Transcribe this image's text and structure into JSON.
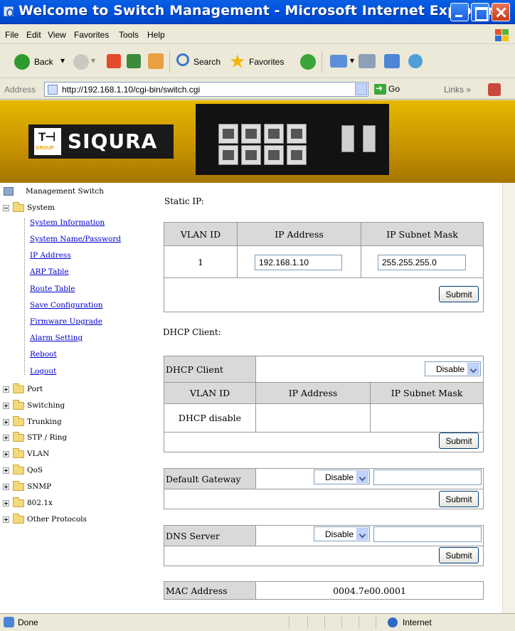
{
  "window": {
    "title": "Welcome to Switch Management - Microsoft Internet Explorer"
  },
  "menu": [
    "File",
    "Edit",
    "View",
    "Favorites",
    "Tools",
    "Help"
  ],
  "toolbar": {
    "back": "Back",
    "search": "Search",
    "favorites": "Favorites"
  },
  "address": {
    "label": "Address",
    "url": "http://192.168.1.10/cgi-bin/switch.cgi",
    "go": "Go",
    "links": "Links"
  },
  "banner": {
    "logo_group": "GROUP",
    "logo_name": "SIQURA"
  },
  "nav": {
    "root": "Management Switch",
    "system": "System",
    "system_items": [
      "System Information",
      "System Name/Password",
      "IP Address",
      "ARP Table",
      "Route Table",
      "Save Configuration",
      "Firmware Upgrade",
      "Alarm Setting",
      "Reboot",
      "Logout"
    ],
    "folders": [
      "Port",
      "Switching",
      "Trunking",
      "STP / Ring",
      "VLAN",
      "QoS",
      "SNMP",
      "802.1x",
      "Other Protocols"
    ]
  },
  "static_ip": {
    "label": "Static IP:",
    "headers": [
      "VLAN ID",
      "IP Address",
      "IP Subnet Mask"
    ],
    "vlan_id": "1",
    "ip": "192.168.1.10",
    "mask": "255.255.255.0",
    "submit": "Submit"
  },
  "dhcp": {
    "label": "DHCP Client:",
    "client_label": "DHCP Client",
    "client_value": "Disable",
    "headers": [
      "VLAN ID",
      "IP Address",
      "IP Subnet Mask"
    ],
    "row_value": "DHCP disable",
    "submit": "Submit"
  },
  "gateway": {
    "label": "Default Gateway",
    "value": "Disable",
    "submit": "Submit"
  },
  "dns": {
    "label": "DNS Server",
    "value": "Disable",
    "submit": "Submit"
  },
  "mac": {
    "label": "MAC Address",
    "value": "0004.7e00.0001"
  },
  "status": {
    "text": "Done",
    "zone": "Internet"
  }
}
